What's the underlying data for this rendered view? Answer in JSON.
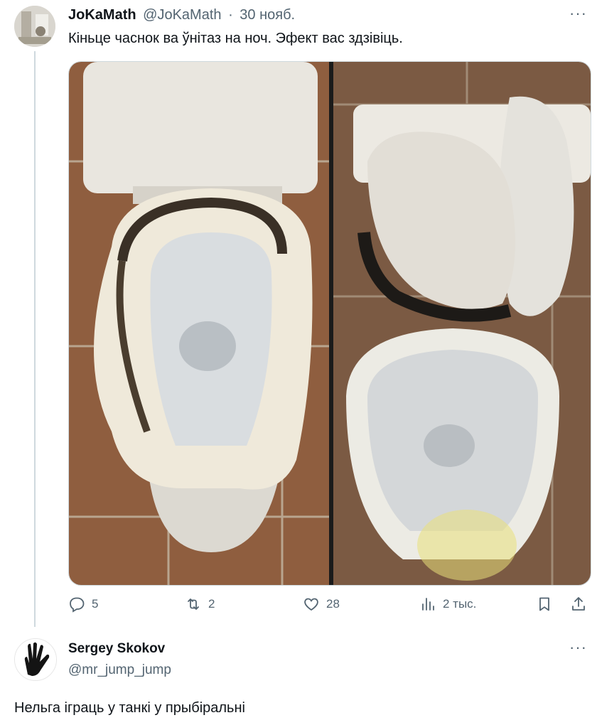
{
  "tweet": {
    "author_name": "JoKaMath",
    "author_handle": "@JoKaMath",
    "separator": "·",
    "date": "30 нояб.",
    "text": "Кіньце часнок ва ўнітаз на ноч. Эфект вас здзівіць.",
    "more_label": "···",
    "media": {
      "description_icon": "toilet-photo",
      "panels": 2
    },
    "actions": {
      "replies": "5",
      "retweets": "2",
      "likes": "28",
      "views": "2 тыс."
    }
  },
  "reply": {
    "author_name": "Sergey Skokov",
    "author_handle": "@mr_jump_jump",
    "more_label": "···",
    "text": "Нельга іграць у танкі у прыбіральні"
  },
  "colors": {
    "text": "#0f1419",
    "muted": "#536471",
    "thread_line": "#cfd9de"
  }
}
